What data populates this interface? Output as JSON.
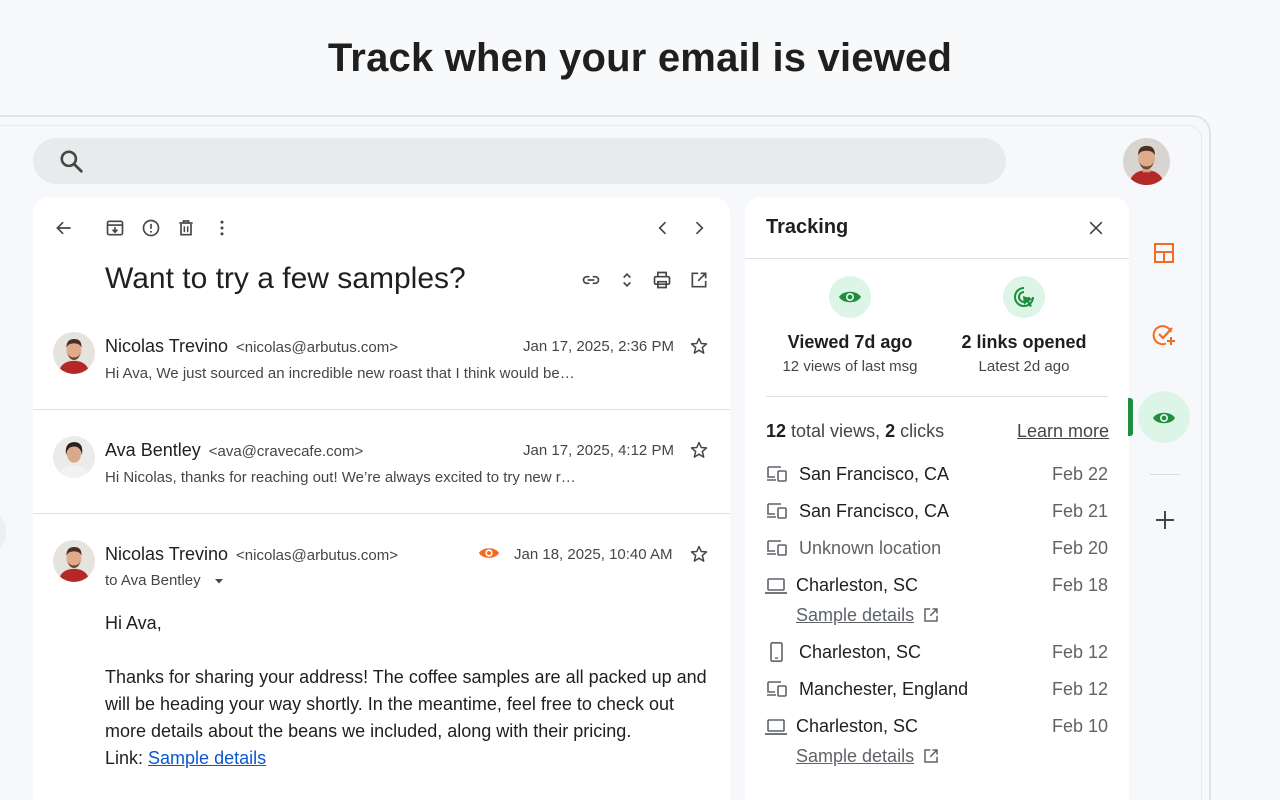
{
  "headline": "Track when your email is viewed",
  "search": {
    "placeholder": ""
  },
  "colors": {
    "accent_green": "#1e8e3e",
    "orange": "#f36c21",
    "link_blue": "#0b57d0"
  },
  "mail": {
    "subject": "Want to try a few samples?",
    "toolbar": [
      "back-arrow-icon",
      "archive-icon",
      "report-spam-icon",
      "delete-icon",
      "more-vert-icon",
      "prev-icon",
      "next-icon"
    ],
    "subject_actions": [
      "link-icon",
      "expand-icon",
      "print-icon",
      "open-new-window-icon"
    ],
    "messages": [
      {
        "sender": "Nicolas Trevino",
        "email": "<nicolas@arbutus.com>",
        "date": "Jan 17, 2025, 2:36 PM",
        "snippet": "Hi Ava, We just sourced an incredible new roast that I think would be…"
      },
      {
        "sender": "Ava Bentley",
        "email": "<ava@cravecafe.com>",
        "date": "Jan 17, 2025, 4:12 PM",
        "snippet": "Hi Nicolas, thanks for reaching out! We’re always excited to try new r…"
      },
      {
        "sender": "Nicolas Trevino",
        "email": "<nicolas@arbutus.com>",
        "date": "Jan 18, 2025, 10:40 AM",
        "to": "to Ava Bentley",
        "greeting": "Hi Ava,",
        "body": "Thanks for sharing your address! The coffee samples are all packed up and will be heading your way shortly. In the meantime, feel free to check out more details about the beans we included, along with their pricing.",
        "link_prefix": "Link: ",
        "link_text": "Sample details"
      }
    ]
  },
  "tracking": {
    "title": "Tracking",
    "viewed_title": "Viewed 7d ago",
    "viewed_sub": "12 views of last msg",
    "links_title": "2 links opened",
    "links_sub": "Latest 2d ago",
    "summary_views_num": "12",
    "summary_views_label": " total views, ",
    "summary_clicks_num": "2",
    "summary_clicks_label": " clicks",
    "learn_more": "Learn more",
    "rows": [
      {
        "device": "desktop-tablet-icon",
        "location": "San Francisco, CA",
        "date": "Feb 22"
      },
      {
        "device": "desktop-tablet-icon",
        "location": "San Francisco, CA",
        "date": "Feb 21"
      },
      {
        "device": "desktop-tablet-icon",
        "location": "Unknown location",
        "date": "Feb 20"
      },
      {
        "device": "laptop-icon",
        "location": "Charleston, SC",
        "date": "Feb 18",
        "link": "Sample details"
      },
      {
        "device": "phone-icon",
        "location": "Charleston, SC",
        "date": "Feb 12"
      },
      {
        "device": "desktop-tablet-icon",
        "location": "Manchester, England",
        "date": "Feb 12"
      },
      {
        "device": "laptop-icon",
        "location": "Charleston, SC",
        "date": "Feb 10",
        "link": "Sample details"
      }
    ]
  },
  "rail": [
    "layout-icon",
    "task-add-icon",
    "eye-icon",
    "add-icon"
  ]
}
